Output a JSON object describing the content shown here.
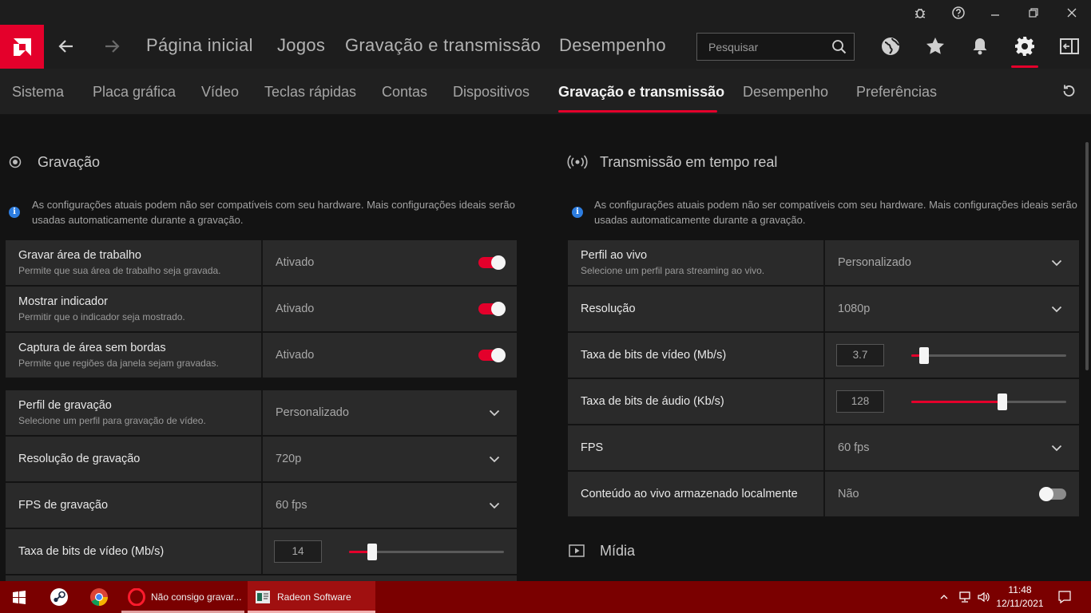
{
  "topnav": {
    "links": [
      "Página inicial",
      "Jogos",
      "Gravação e transmissão",
      "Desempenho"
    ],
    "search_placeholder": "Pesquisar"
  },
  "subnav": {
    "tabs": [
      "Sistema",
      "Placa gráfica",
      "Vídeo",
      "Teclas rápidas",
      "Contas",
      "Dispositivos",
      "Gravação e transmissão",
      "Desempenho",
      "Preferências"
    ],
    "active_tab": "Gravação e transmissão"
  },
  "recording": {
    "title": "Gravação",
    "info": "As configurações atuais podem não ser compatíveis com seu hardware. Mais configurações ideais serão usadas automaticamente durante a gravação.",
    "group1": [
      {
        "label": "Gravar área de trabalho",
        "sub": "Permite que sua área de trabalho seja gravada.",
        "value": "Ativado",
        "on": true
      },
      {
        "label": "Mostrar indicador",
        "sub": "Permitir que o indicador seja mostrado.",
        "value": "Ativado",
        "on": true
      },
      {
        "label": "Captura de área sem bordas",
        "sub": "Permite que regiões da janela sejam gravadas.",
        "value": "Ativado",
        "on": true
      }
    ],
    "group2": [
      {
        "label": "Perfil de gravação",
        "sub": "Selecione um perfil para gravação de vídeo.",
        "value": "Personalizado"
      },
      {
        "label": "Resolução de gravação",
        "value": "720p"
      },
      {
        "label": "FPS de gravação",
        "value": "60 fps"
      },
      {
        "label": "Taxa de bits de vídeo (Mb/s)",
        "value": "14",
        "slider_fraction": 0.15
      }
    ]
  },
  "streaming": {
    "title": "Transmissão em tempo real",
    "info": "As configurações atuais podem não ser compatíveis com seu hardware. Mais configurações ideais serão usadas automaticamente durante a gravação.",
    "rows": [
      {
        "label": "Perfil ao vivo",
        "sub": "Selecione um perfil para streaming ao vivo.",
        "value": "Personalizado"
      },
      {
        "label": "Resolução",
        "value": "1080p"
      },
      {
        "label": "Taxa de bits de vídeo (Mb/s)",
        "value": "3.7",
        "slider_fraction": 0.08
      },
      {
        "label": "Taxa de bits de áudio (Kb/s)",
        "value": "128",
        "slider_fraction": 0.59
      },
      {
        "label": "FPS",
        "value": "60 fps"
      },
      {
        "label": "Conteúdo ao vivo armazenado localmente",
        "value": "Não",
        "on": false
      }
    ]
  },
  "media": {
    "title": "Mídia"
  },
  "taskbar": {
    "apps": [
      "Não consigo gravar...",
      "Radeon Software"
    ],
    "time": "11:48",
    "date": "12/11/2021"
  },
  "colors": {
    "accent": "#e4002b",
    "taskbar": "#7a0000"
  }
}
